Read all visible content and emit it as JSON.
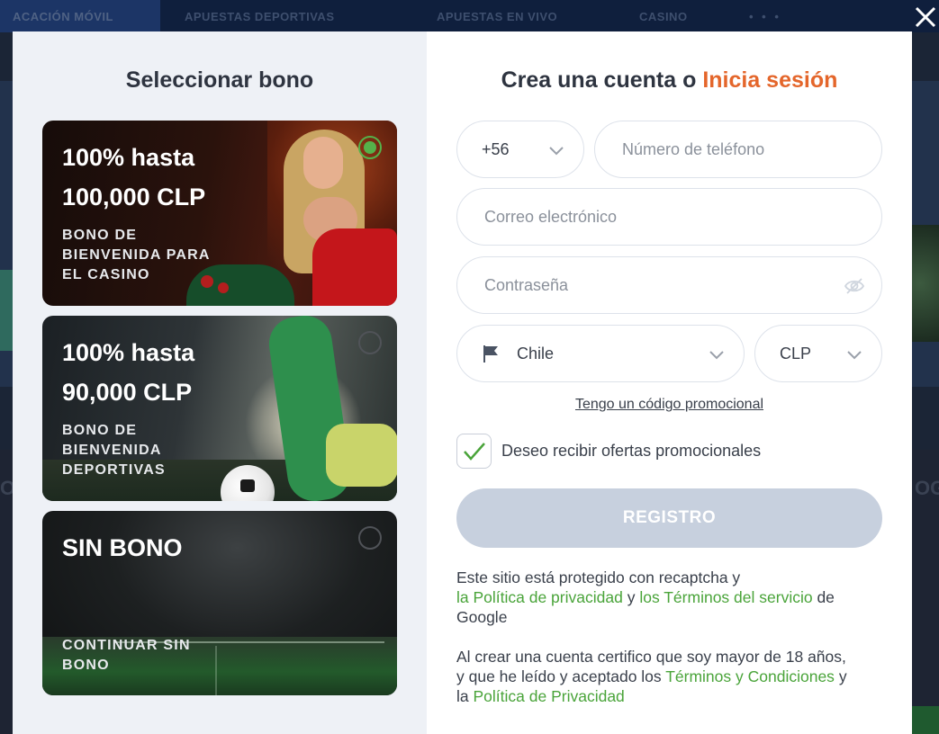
{
  "background": {
    "nav_tabs": [
      "ACACIÓN MÓVIL",
      "APUESTAS DEPORTIVAS",
      "APUESTAS EN VIVO",
      "CASINO",
      "• • •"
    ]
  },
  "colors": {
    "accent_orange": "#e4662b",
    "link_green": "#4aa43a",
    "radio_green": "#55b24a",
    "button_disabled": "#c7d0de"
  },
  "bonus": {
    "title": "Seleccionar bono",
    "cards": [
      {
        "title_line1": "100% hasta",
        "title_line2": "100,000 CLP",
        "subtitle_lines": [
          "BONO DE",
          "BIENVENIDA PARA",
          "EL CASINO"
        ],
        "selected": true
      },
      {
        "title_line1": "100% hasta",
        "title_line2": "90,000 CLP",
        "subtitle_lines": [
          "BONO DE",
          "BIENVENIDA",
          "DEPORTIVAS"
        ],
        "selected": false
      },
      {
        "title_line1": "SIN BONO",
        "title_line2": "",
        "subtitle_lines": [
          "CONTINUAR SIN",
          "BONO"
        ],
        "selected": false
      }
    ]
  },
  "form": {
    "title_prefix": "Crea una cuenta o",
    "title_login": "Inicia sesión",
    "phone_code": "+56",
    "phone_placeholder": "Número de teléfono",
    "email_placeholder": "Correo electrónico",
    "password_placeholder": "Contraseña",
    "country": "Chile",
    "currency": "CLP",
    "promo_link": "Tengo un código promocional",
    "offers_checkbox_label": "Deseo recibir ofertas promocionales",
    "offers_checked": true,
    "register_button": "REGISTRO"
  },
  "legal": {
    "recaptcha_text_1": "Este sitio está protegido con recaptcha y",
    "privacy_policy_link": "la Política de privacidad",
    "and": "y",
    "terms_service_link": "los Términos del servicio",
    "of": "de",
    "google": "Google",
    "age_text_1": "Al crear una cuenta certifico que soy mayor de 18 años,",
    "age_text_2": "y que he leído y aceptado los",
    "terms_conditions_link": "Términos y Condiciones",
    "the": "la",
    "privacy_policy_link_2": "Política de Privacidad"
  }
}
